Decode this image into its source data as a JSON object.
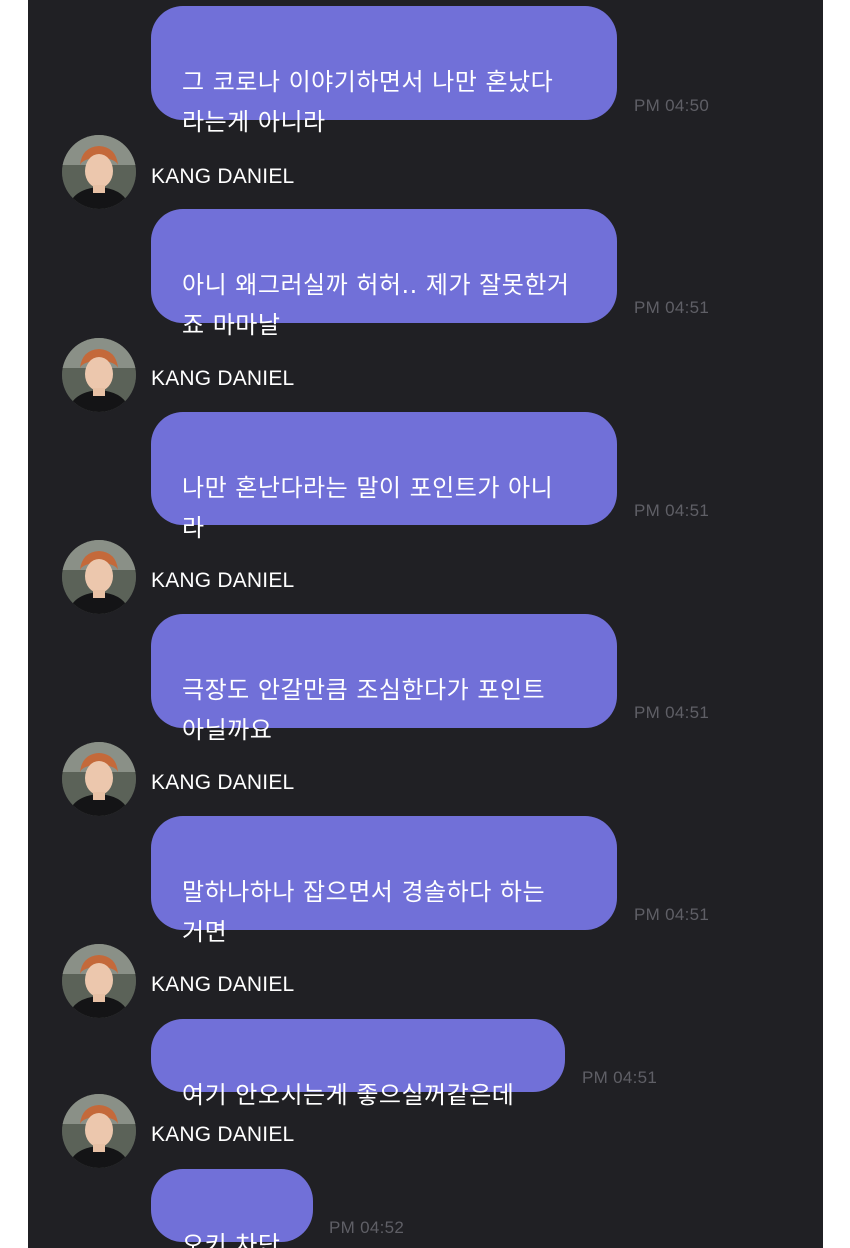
{
  "colors": {
    "background": "#202024",
    "bubble": "#7170d8",
    "bubble_text": "#ffffff",
    "timestamp": "#5f5f66",
    "sender_name": "#ffffff"
  },
  "messages": [
    {
      "sender": "",
      "text": "그 코로나 이야기하면서 나만 혼났다\n라는게 아니라",
      "time": "PM 04:50"
    },
    {
      "sender": "KANG DANIEL",
      "avatar_icon": "profile-photo",
      "text": "아니 왜그러실까 허허.. 제가 잘못한거\n죠 마마날",
      "time": "PM 04:51"
    },
    {
      "sender": "KANG DANIEL",
      "avatar_icon": "profile-photo",
      "text": "나만 혼난다라는 말이 포인트가 아니\n라",
      "time": "PM 04:51"
    },
    {
      "sender": "KANG DANIEL",
      "avatar_icon": "profile-photo",
      "text": "극장도 안갈만큼 조심한다가 포인트\n아닐까요",
      "time": "PM 04:51"
    },
    {
      "sender": "KANG DANIEL",
      "avatar_icon": "profile-photo",
      "text": "말하나하나 잡으면서 경솔하다 하는\n거면",
      "time": "PM 04:51"
    },
    {
      "sender": "KANG DANIEL",
      "avatar_icon": "profile-photo",
      "text": "여기 안오시는게 좋으실꺼같은데",
      "time": "PM 04:51"
    },
    {
      "sender": "KANG DANIEL",
      "avatar_icon": "profile-photo",
      "text": "오키 차단",
      "time": "PM 04:52"
    }
  ]
}
